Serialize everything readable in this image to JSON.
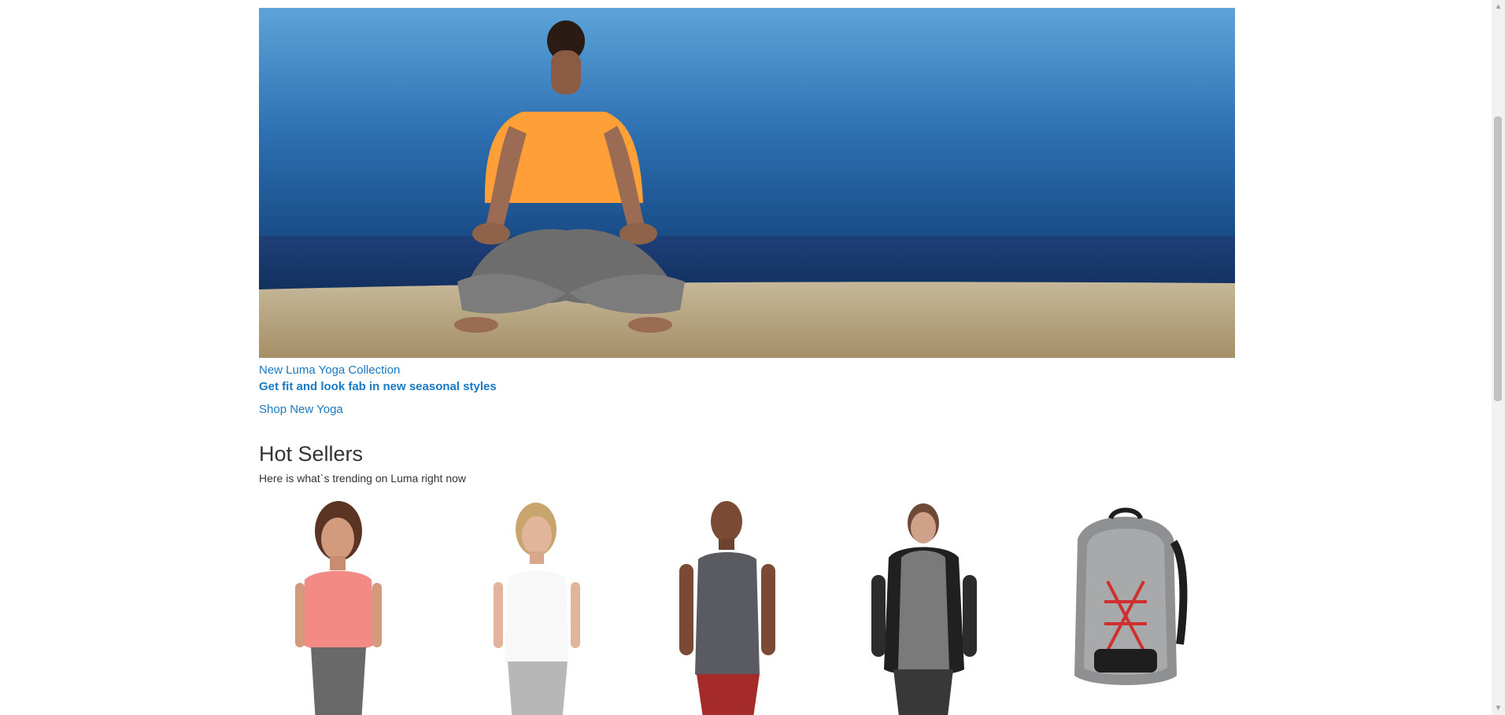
{
  "hero": {
    "title_link": "New Luma Yoga Collection",
    "subtitle": "Get fit and look fab in new seasonal styles",
    "cta": "Shop New Yoga"
  },
  "hot_sellers": {
    "heading": "Hot Sellers",
    "description": "Here is what`s trending on Luma right now"
  },
  "products": [
    {
      "name": "salmon-women-tee",
      "color": "#f58c87"
    },
    {
      "name": "white-women-tank",
      "color": "#f6f6f6"
    },
    {
      "name": "gray-men-sleeveless",
      "color": "#58595d"
    },
    {
      "name": "black-gray-men-hoodie",
      "color": "#2a2a2a"
    },
    {
      "name": "gray-red-backpack",
      "color": "#8d8f91"
    }
  ],
  "colors": {
    "link_blue": "#1979c3",
    "text_dark": "#333333",
    "scrollbar_bg": "#f1f1f1",
    "scroll_thumb": "#c1c1c1"
  },
  "icons": {
    "scroll_up": "scroll-up-arrow-icon",
    "scroll_down": "scroll-down-arrow-icon"
  }
}
